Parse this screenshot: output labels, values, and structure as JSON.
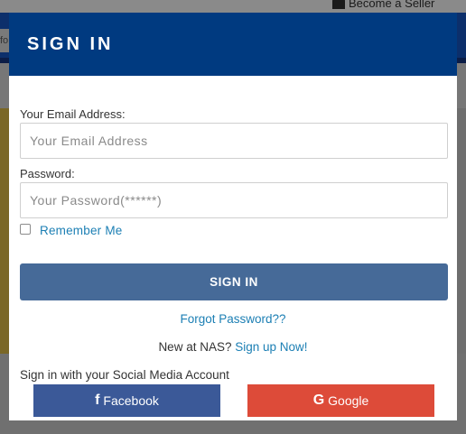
{
  "background": {
    "top_link": "Become a Seller",
    "search_stub": "fo"
  },
  "modal": {
    "title": "SIGN IN",
    "email": {
      "label": "Your Email Address:",
      "placeholder": "Your Email Address",
      "value": ""
    },
    "password": {
      "label": "Password:",
      "placeholder": "Your Password(******)",
      "value": ""
    },
    "remember_me": {
      "label": "Remember Me",
      "checked": false
    },
    "submit_label": "SIGN IN",
    "forgot_link": "Forgot Password??",
    "new_prompt": "New at NAS?",
    "signup_link": "Sign up Now!",
    "social_prompt": "Sign in with your Social Media Account",
    "social": {
      "facebook_label": "Facebook",
      "google_label": "Google"
    }
  },
  "colors": {
    "header": "#003a80",
    "signin_button": "#466a98",
    "link": "#1c7fb4",
    "facebook": "#3b5998",
    "google": "#dd4b39"
  },
  "icons": {
    "facebook": "facebook-icon",
    "google": "google-icon",
    "store": "store-icon"
  }
}
